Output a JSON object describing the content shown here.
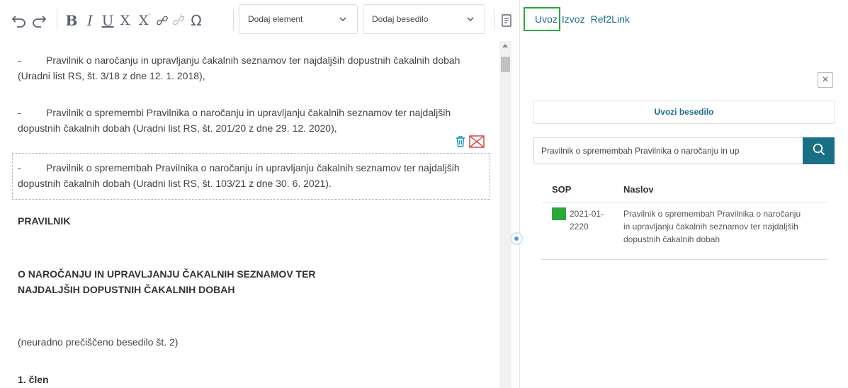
{
  "toolbar": {
    "icons": [
      "undo-icon",
      "redo-icon",
      "bold-icon",
      "italic-icon",
      "underline-icon",
      "subscript-icon",
      "superscript-icon",
      "link-icon",
      "unlink-icon",
      "special-char-icon",
      "document-icon"
    ],
    "add_element": "Dodaj element",
    "add_text": "Dodaj besedilo"
  },
  "tabs": {
    "uvoz": "Uvoz",
    "izvoz": "Izvoz",
    "ref2link": "Ref2Link"
  },
  "colors": {
    "accent": "#1b6f85",
    "link": "#1d6f8a",
    "active_tab_border": "#29a83a",
    "status_green": "#2ea73a",
    "delete_red": "#d9534f"
  },
  "editor": {
    "p1": "Pravilnik o naročanju in upravljanju čakalnih seznamov ter najdaljših dopustnih čakalnih dobah (Uradni list RS, št. 3/18 z dne 12. 1. 2018),",
    "p2": "Pravilnik o spremembi Pravilnika o naročanju in upravljanju čakalnih seznamov ter najdaljših dopustnih čakalnih dobah (Uradni list RS, št. 201/20 z dne 29. 12. 2020),",
    "p3": "Pravilnik o spremembah Pravilnika o naročanju in upravljanju čakalnih seznamov ter najdaljših dopustnih čakalnih dobah (Uradni list RS, št. 103/21 z dne 30. 6. 2021).",
    "dash": "-",
    "heading1": "PRAVILNIK",
    "heading2": "O NAROČANJU IN UPRAVLJANJU ČAKALNIH SEZNAMOV TER NAJDALJŠIH DOPUSTNIH ČAKALNIH DOBAH",
    "note": "(neuradno prečiščeno besedilo št. 2)",
    "article": "1. člen"
  },
  "panel": {
    "close": "×",
    "import_button": "Uvozi besedilo",
    "search_value": "Pravilnik o spremembah Pravilnika o naročanju in up",
    "columns": [
      "SOP",
      "Naslov"
    ],
    "rows": [
      {
        "sop": "2021-01-2220",
        "title": "Pravilnik o spremembah Pravilnika o naročanju in upravljanju čakalnih seznamov ter najdaljših dopustnih čakalnih dobah"
      }
    ]
  }
}
